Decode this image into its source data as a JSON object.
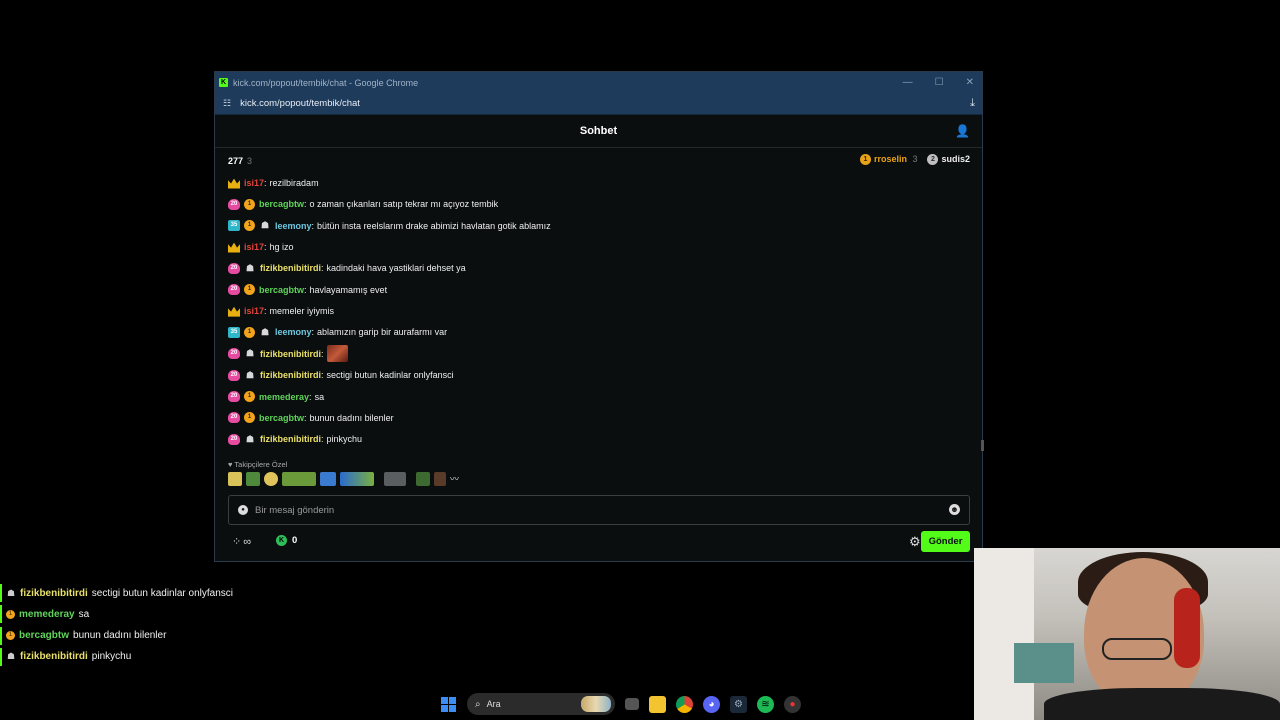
{
  "window": {
    "title": "kick.com/popout/tembik/chat - Google Chrome",
    "url": "kick.com/popout/tembik/chat"
  },
  "chat": {
    "header_title": "Sohbet",
    "viewers": "277",
    "viewers_extra": "3",
    "leaders": [
      {
        "rank": "1",
        "name": "rroselin",
        "count": "3",
        "color": "#e8a21a"
      },
      {
        "rank": "2",
        "name": "sudis2",
        "count": "",
        "color": "#bfbfbf"
      }
    ],
    "messages": [
      {
        "badges": [
          "crown"
        ],
        "user": "isi17",
        "user_color": "red",
        "text": "rezilbiradam"
      },
      {
        "badges": [
          "sub",
          "gift"
        ],
        "user": "bercagbtw",
        "user_color": "green",
        "text": "o zaman çıkanları satıp tekrar mı açıyoz tembik"
      },
      {
        "badges": [
          "sub2",
          "gift",
          "og"
        ],
        "user": "leemony",
        "user_color": "blue",
        "text": "bütün insta reelslarım drake abimizi havlatan gotik ablamız"
      },
      {
        "badges": [
          "crown"
        ],
        "user": "isi17",
        "user_color": "red",
        "text": "hg izo"
      },
      {
        "badges": [
          "sub",
          "og"
        ],
        "user": "fizikbenibitirdi",
        "user_color": "yellow",
        "text": "kadindaki hava yastiklari dehset ya"
      },
      {
        "badges": [
          "sub",
          "gift"
        ],
        "user": "bercagbtw",
        "user_color": "green",
        "text": "havlayamamış evet"
      },
      {
        "badges": [
          "crown"
        ],
        "user": "isi17",
        "user_color": "red",
        "text": "memeler iyiymis"
      },
      {
        "badges": [
          "sub2",
          "gift",
          "og"
        ],
        "user": "leemony",
        "user_color": "blue",
        "text": "ablamızın garip bir aurafarmı var"
      },
      {
        "badges": [
          "sub",
          "og"
        ],
        "user": "fizikbenibitirdi",
        "user_color": "yellow",
        "text": "",
        "emote": true
      },
      {
        "badges": [
          "sub",
          "og"
        ],
        "user": "fizikbenibitirdi",
        "user_color": "yellow",
        "text": "sectigi butun kadinlar onlyfansci"
      },
      {
        "badges": [
          "sub",
          "gift"
        ],
        "user": "memederay",
        "user_color": "green",
        "text": "sa"
      },
      {
        "badges": [
          "sub",
          "gift"
        ],
        "user": "bercagbtw",
        "user_color": "green",
        "text": "bunun dadını bilenler"
      },
      {
        "badges": [
          "sub",
          "og"
        ],
        "user": "fizikbenibitirdi",
        "user_color": "yellow",
        "text": "pinkychu"
      }
    ],
    "emote_section_label": "Takipçilere Özel",
    "input_placeholder": "Bir mesaj gönderin",
    "points": "∞",
    "kick_coins": "0",
    "send_label": "Gönder"
  },
  "overlay": [
    {
      "icon": "og",
      "user": "fizikbenibitirdi",
      "color": "yellow",
      "text": "sectigi butun kadinlar onlyfansci"
    },
    {
      "icon": "gift",
      "user": "memederay",
      "color": "green",
      "text": "sa"
    },
    {
      "icon": "gift",
      "user": "bercagbtw",
      "color": "green",
      "text": "bunun dadını bilenler"
    },
    {
      "icon": "og",
      "user": "fizikbenibitirdi",
      "color": "yellow",
      "text": "pinkychu"
    }
  ],
  "taskbar": {
    "search_label": "Ara",
    "apps": [
      "task-view",
      "file-explorer",
      "chrome",
      "discord",
      "steam",
      "spotify",
      "app-red"
    ]
  },
  "colors": {
    "kick_green": "#53fc18",
    "titlebar": "#1f3b5c"
  }
}
